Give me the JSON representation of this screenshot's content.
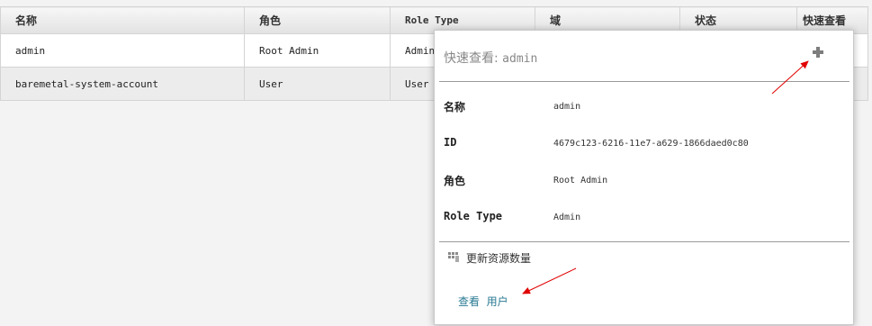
{
  "table": {
    "headers": [
      "名称",
      "角色",
      "Role Type",
      "域",
      "状态",
      "快速查看"
    ],
    "rows": [
      [
        "admin",
        "Root Admin",
        "Admin",
        "",
        "",
        ""
      ],
      [
        "baremetal-system-account",
        "User",
        "User",
        "",
        "",
        ""
      ]
    ]
  },
  "quickview": {
    "title_prefix": "快速查看: ",
    "title_value": "admin",
    "fields": [
      {
        "label": "名称",
        "value": "admin"
      },
      {
        "label": "ID",
        "value": "4679c123-6216-11e7-a629-1866daed0c80"
      },
      {
        "label": "角色",
        "value": "Root Admin"
      },
      {
        "label": "Role Type",
        "value": "Admin"
      }
    ],
    "action_label": "更新资源数量",
    "view_prefix": "查看",
    "view_link": "用户",
    "plus_icon": "plus-icon",
    "action_icon": "update-resource-icon"
  },
  "colors": {
    "link": "#2a7a93",
    "annotation_arrow": "#e00000"
  }
}
